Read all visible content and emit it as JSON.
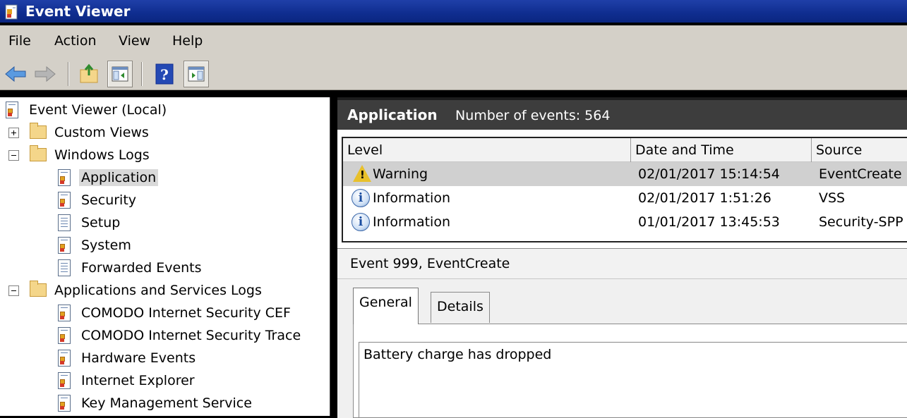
{
  "window": {
    "title": "Event Viewer"
  },
  "menu": [
    "File",
    "Action",
    "View",
    "Help"
  ],
  "toolbar": {
    "icons": [
      "back-arrow-icon",
      "forward-arrow-icon",
      "up-folder-icon",
      "show-hide-tree-icon",
      "help-icon",
      "show-hide-action-pane-icon"
    ]
  },
  "tree": {
    "root": "Event Viewer (Local)",
    "custom_views": "Custom Views",
    "windows_logs": "Windows Logs",
    "windows_log_items": [
      "Application",
      "Security",
      "Setup",
      "System",
      "Forwarded Events"
    ],
    "apps_services": "Applications and Services Logs",
    "apps_services_items": [
      "COMODO Internet Security CEF",
      "COMODO Internet Security Trace",
      "Hardware Events",
      "Internet Explorer",
      "Key Management Service"
    ]
  },
  "log_header": {
    "name": "Application",
    "count_text": "Number of events: 564"
  },
  "grid": {
    "columns": [
      "Level",
      "Date and Time",
      "Source"
    ],
    "rows": [
      {
        "level": "Warning",
        "date": "02/01/2017 15:14:54",
        "source": "EventCreate"
      },
      {
        "level": "Information",
        "date": "02/01/2017 1:51:26",
        "source": "VSS"
      },
      {
        "level": "Information",
        "date": "01/01/2017 13:45:53",
        "source": "Security-SPP"
      }
    ]
  },
  "detail": {
    "title": "Event 999, EventCreate",
    "tabs": [
      "General",
      "Details"
    ],
    "description": "Battery charge has dropped"
  }
}
